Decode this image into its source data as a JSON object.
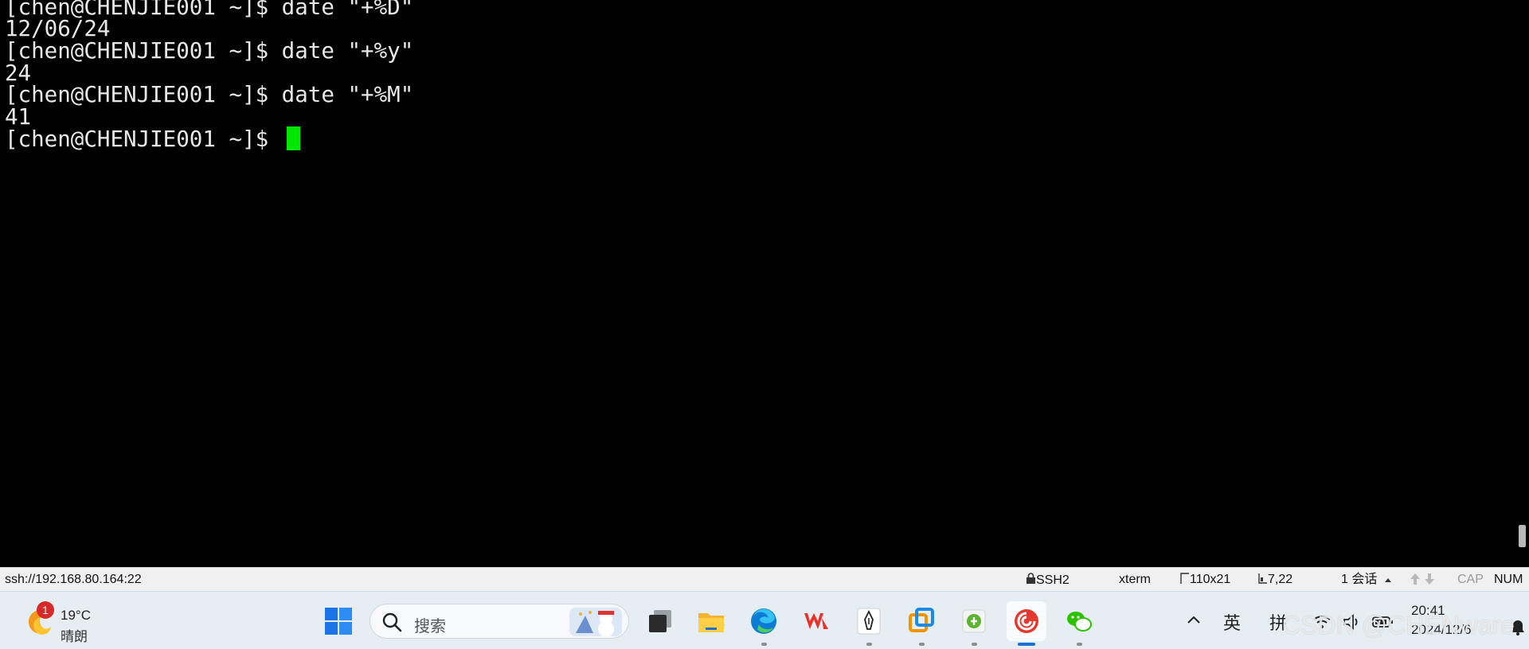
{
  "terminal": {
    "lines": [
      "[chen@CHENJIE001 ~]$ date \"+%D\"",
      "12/06/24",
      "[chen@CHENJIE001 ~]$ date \"+%y\"",
      "24",
      "[chen@CHENJIE001 ~]$ date \"+%M\"",
      "41",
      "[chen@CHENJIE001 ~]$ "
    ],
    "cursor_color": "#00e800"
  },
  "statusbar": {
    "connection": "ssh://192.168.80.164:22",
    "protocol": "SSH2",
    "terminal_type": "xterm",
    "size": "110x21",
    "position": "7,22",
    "sessions": "1 会话",
    "cap": "CAP",
    "num": "NUM"
  },
  "taskbar": {
    "weather": {
      "badge": "1",
      "temperature": "19°C",
      "condition": "晴朗"
    },
    "search": {
      "placeholder": "搜索"
    },
    "apps": [
      {
        "name": "windows-start-icon"
      },
      {
        "name": "task-view-icon"
      },
      {
        "name": "file-explorer-icon"
      },
      {
        "name": "edge-browser-icon"
      },
      {
        "name": "wps-office-icon"
      },
      {
        "name": "pen-app-icon"
      },
      {
        "name": "vmware-icon"
      },
      {
        "name": "green-app-icon"
      },
      {
        "name": "securecrt-icon"
      },
      {
        "name": "wechat-icon"
      }
    ],
    "tray": {
      "ime_lang": "英",
      "ime_mode": "拼",
      "time": "20:41",
      "date": "2024/12/6"
    },
    "watermark": "CSDN @CHENware"
  }
}
